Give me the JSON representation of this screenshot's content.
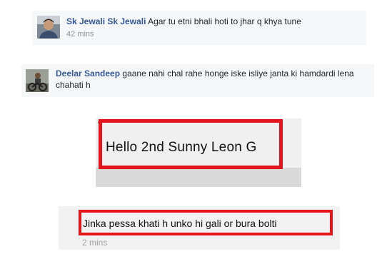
{
  "comments": [
    {
      "author": "Sk Jewali Sk Jewali",
      "text": "Agar tu etni bhali hoti to jhar q khya tune",
      "time": "42 mins"
    },
    {
      "author": "Deelar Sandeep",
      "text": "gaane nahi chal rahe honge iske isliye janta ki hamdardi lena chahati h"
    }
  ],
  "highlights": [
    {
      "text": "Hello 2nd Sunny Leon G"
    },
    {
      "text": "Jinka pessa khati h unko hi gali or bura bolti",
      "time": "2 mins"
    }
  ],
  "colors": {
    "highlight_border": "#e3141b",
    "author_link": "#365899",
    "comment_bg": "#f6f7f9"
  },
  "icons": [
    "avatar-photo"
  ]
}
